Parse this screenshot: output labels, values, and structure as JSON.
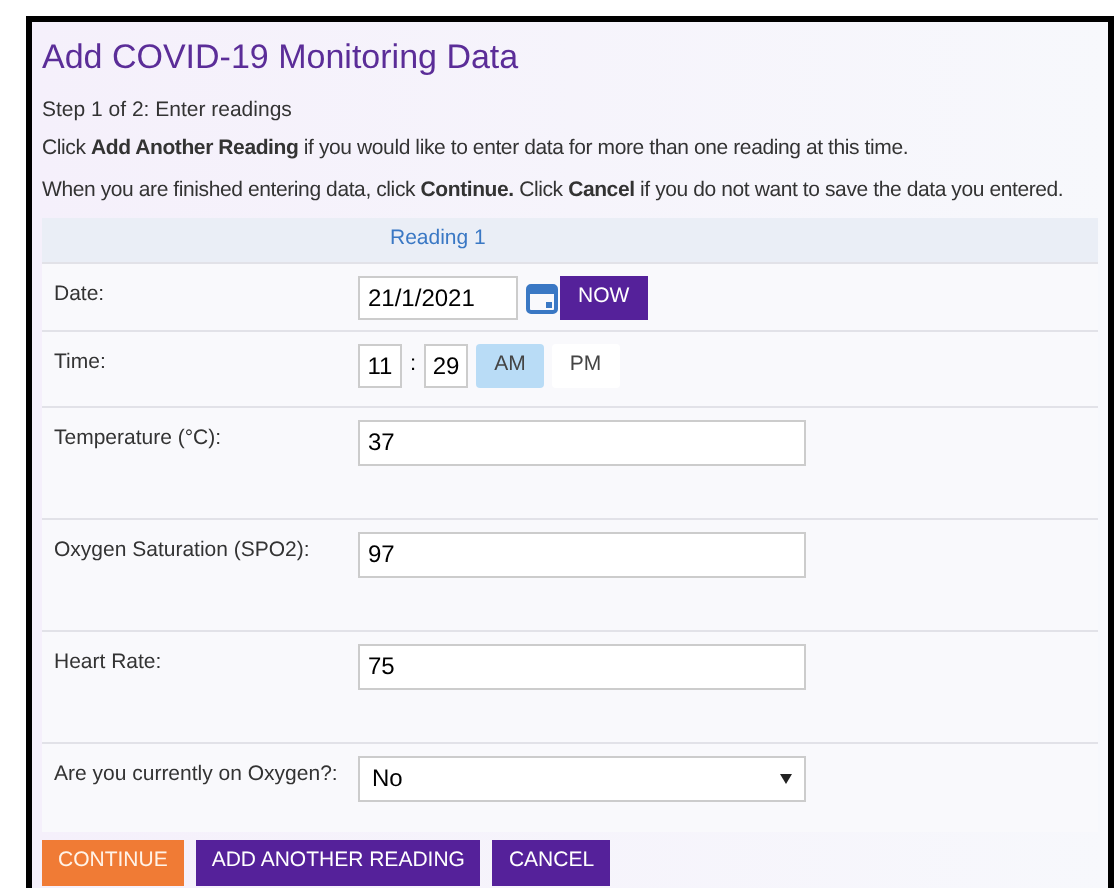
{
  "title": "Add COVID-19 Monitoring Data",
  "step": "Step 1 of 2: Enter readings",
  "instructions": [
    "Click **Add Another Reading** if you would like to enter data for more than one reading at this time.",
    "When you are finished entering data, click **Continue.** Click **Cancel** if you do not want to save the data you entered."
  ],
  "column": "Reading 1",
  "rows": [
    {
      "kind": "date",
      "label": "Date:",
      "value": "21/1/2021",
      "button": "NOW"
    },
    {
      "kind": "time",
      "label": "Time:",
      "hour": "11",
      "separator": ":",
      "minute": "29",
      "periods": [
        {
          "label": "AM",
          "selected": true
        },
        {
          "label": "PM",
          "selected": false
        }
      ]
    },
    {
      "kind": "text",
      "label": "Temperature (°C):",
      "value": "37"
    },
    {
      "kind": "text",
      "label": "Oxygen Saturation (SPO2):",
      "value": "97"
    },
    {
      "kind": "text",
      "label": "Heart Rate:",
      "value": "75"
    },
    {
      "kind": "select",
      "label": "Are you currently on Oxygen?:",
      "value": "No"
    }
  ],
  "buttons": [
    {
      "label": "CONTINUE",
      "kind": "primary"
    },
    {
      "label": "ADD ANOTHER READING",
      "kind": "secondary"
    },
    {
      "label": "CANCEL",
      "kind": "secondary"
    }
  ]
}
